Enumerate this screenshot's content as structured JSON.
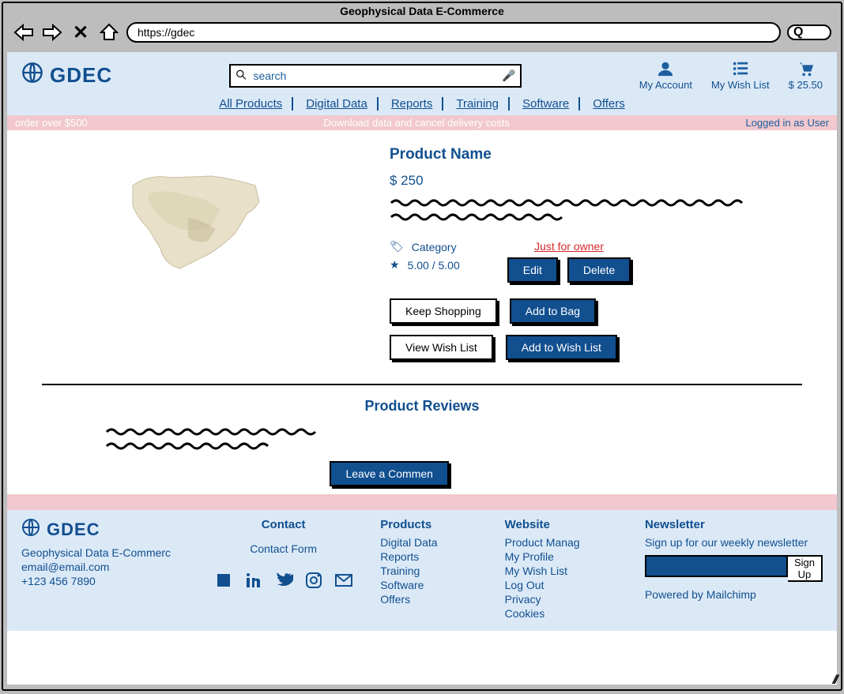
{
  "browser": {
    "title": "Geophysical Data E-Commerce",
    "url": "https://gdec"
  },
  "brand": "GDEC",
  "search_placeholder": "search",
  "header_actions": {
    "account": "My Account",
    "wishlist": "My Wish List",
    "cart": "$  25.50"
  },
  "nav": [
    "All Products",
    "Digital Data",
    "Reports",
    "Training",
    "Software",
    "Offers"
  ],
  "promo": {
    "left": "order over $500",
    "center": "Download data and cancel delivery costs",
    "right": "Logged in as User"
  },
  "product": {
    "name": "Product Name",
    "price": "$  250",
    "category_label": "Category",
    "rating": "5.00 / 5.00",
    "owner_label": "Just for owner",
    "edit": "Edit",
    "delete": "Delete",
    "keep_shopping": "Keep Shopping",
    "add_to_bag": "Add to Bag",
    "view_wishlist": "View Wish List",
    "add_to_wishlist": "Add to Wish List"
  },
  "reviews": {
    "heading": "Product Reviews",
    "leave_comment": "Leave a Commen"
  },
  "footer": {
    "brand": "GDEC",
    "tagline": "Geophysical Data E-Commerc",
    "email": "email@email.com",
    "phone": "+123 456 7890",
    "contact_h": "Contact",
    "contact_form": "Contact Form",
    "products_h": "Products",
    "products": [
      "Digital Data",
      "Reports",
      "Training",
      "Software",
      "Offers"
    ],
    "website_h": "Website",
    "website": [
      "Product Manag",
      "My Profile",
      "My Wish List",
      "Log Out",
      "Privacy",
      "Cookies"
    ],
    "newsletter_h": "Newsletter",
    "newsletter_text": "Sign up for our weekly newsletter",
    "signup": "Sign Up",
    "powered": "Powered by Mailchimp"
  }
}
